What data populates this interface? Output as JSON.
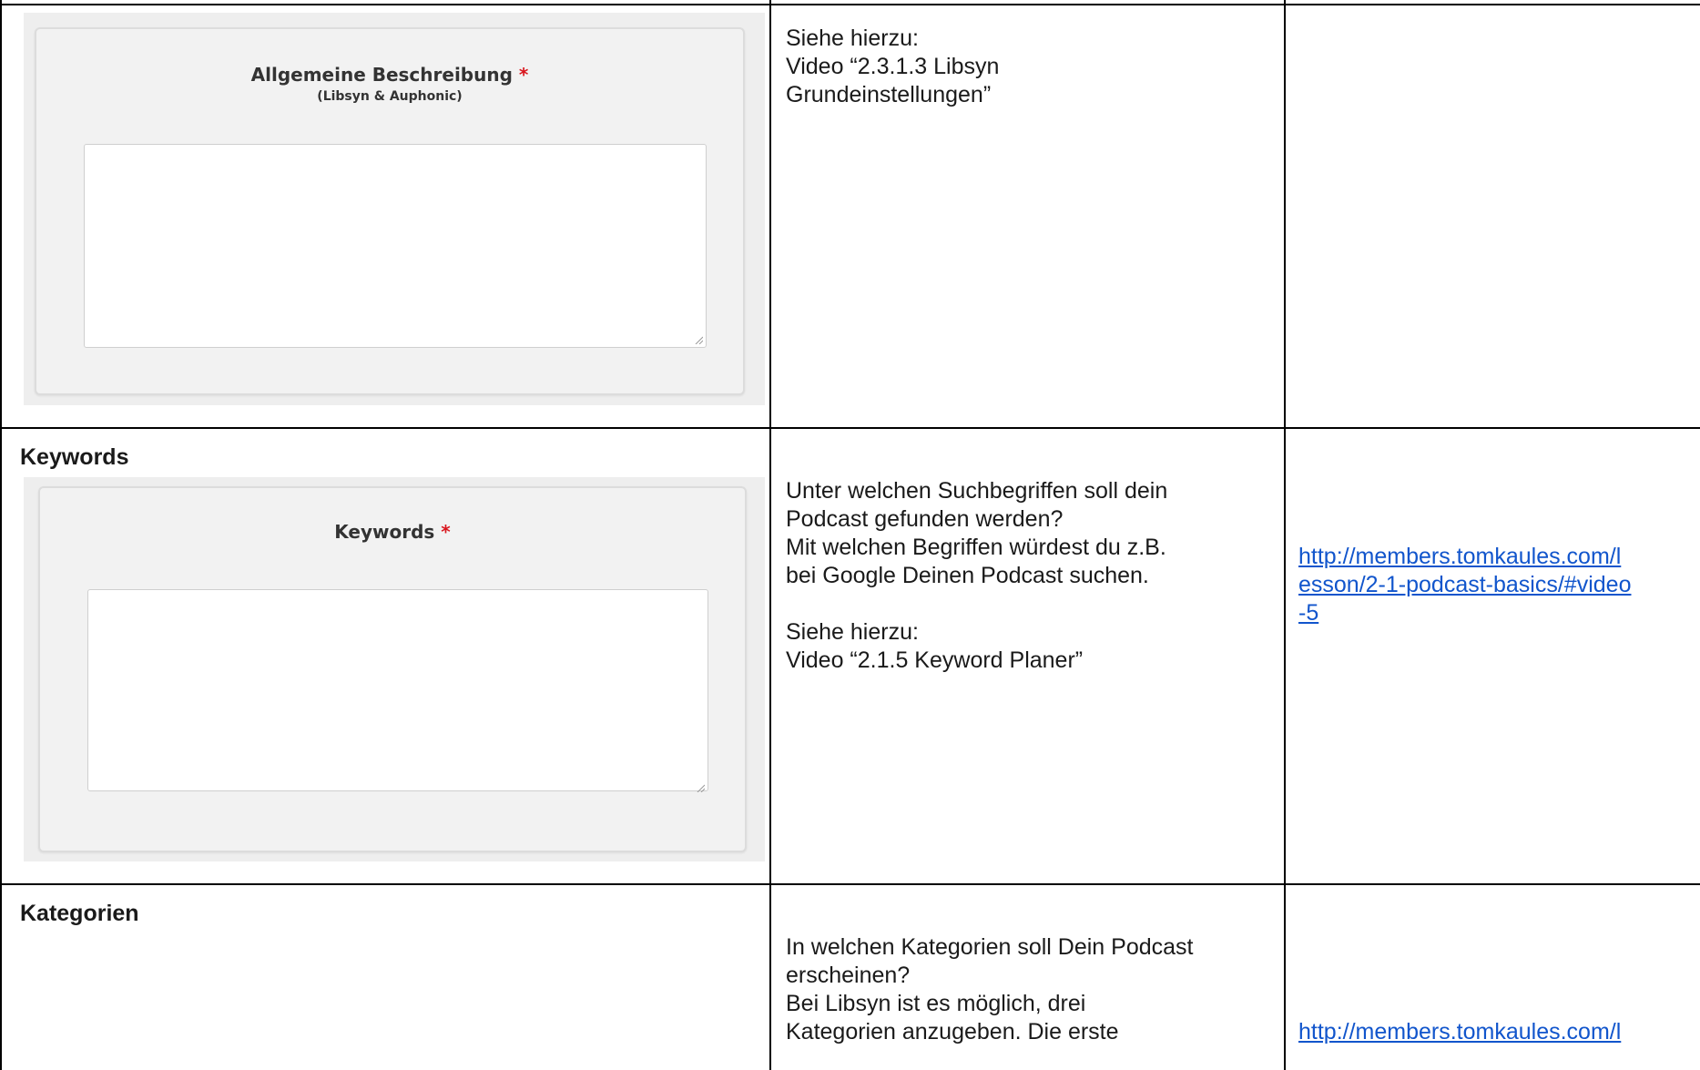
{
  "rows": [
    {
      "label": "",
      "form": {
        "title": "Allgemeine Beschreibung",
        "required_mark": "*",
        "subtitle": "(Libsyn & Auphonic)",
        "textarea_value": ""
      },
      "description_lines": [
        "Siehe hierzu:",
        "Video “2.3.1.3 Libsyn",
        "Grundeinstellungen”"
      ],
      "link_lines": []
    },
    {
      "label": "Keywords",
      "form": {
        "title": "Keywords",
        "required_mark": "*",
        "textarea_value": ""
      },
      "description_lines": [
        "Unter welchen Suchbegriffen soll dein",
        "Podcast gefunden werden?",
        "Mit welchen Begriffen würdest du z.B.",
        "bei Google Deinen Podcast suchen.",
        "",
        "Siehe hierzu:",
        "Video “2.1.5 Keyword Planer”"
      ],
      "link_lines": [
        "http://members.tomkaules.com/l",
        "esson/2-1-podcast-basics/#video",
        "-5"
      ]
    },
    {
      "label": "Kategorien",
      "description_lines": [
        "In welchen Kategorien soll Dein Podcast",
        "erscheinen?",
        "Bei Libsyn ist es möglich, drei",
        "Kategorien anzugeben. Die erste"
      ],
      "link_lines": [
        "http://members.tomkaules.com/l"
      ]
    }
  ]
}
